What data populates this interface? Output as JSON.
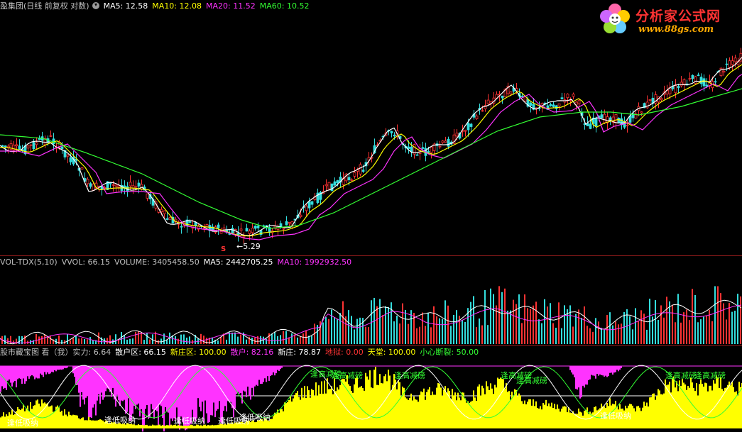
{
  "price_header": {
    "title": "盈集团(日线 前复权 对数)",
    "items": [
      {
        "label": "MA5: 12.58",
        "color": "#ffffff"
      },
      {
        "label": "MA10: 12.08",
        "color": "#ffff00"
      },
      {
        "label": "MA20: 11.52",
        "color": "#ff33ff"
      },
      {
        "label": "MA60: 10.52",
        "color": "#33ff33"
      }
    ]
  },
  "low_marker": {
    "label": "5.29",
    "glyph": "S"
  },
  "logo": {
    "title": "分析家公式网",
    "url": "www.88gs.com",
    "icon": "flower-icon"
  },
  "vol_header": {
    "items": [
      {
        "label": "VOL-TDX(5,10)",
        "color": "#c0c0c0"
      },
      {
        "label": "VVOL: 66.15",
        "color": "#c0c0c0"
      },
      {
        "label": "VOLUME: 3405458.50",
        "color": "#c0c0c0"
      },
      {
        "label": "MA5: 2442705.25",
        "color": "#ffffff"
      },
      {
        "label": "MA10: 1992932.50",
        "color": "#ff33ff"
      }
    ]
  },
  "ind_header": {
    "items": [
      {
        "label": "股市藏宝图 看（我）实力: 6.64",
        "color": "#c0c0c0"
      },
      {
        "label": "散户区: 66.15",
        "color": "#ffffff"
      },
      {
        "label": "新庄区: 100.00",
        "color": "#ffff00"
      },
      {
        "label": "散户: 82.16",
        "color": "#ff33ff"
      },
      {
        "label": "新庄: 78.87",
        "color": "#ffffff"
      },
      {
        "label": "地狱: 0.00",
        "color": "#ff3333"
      },
      {
        "label": "天堂: 100.00",
        "color": "#ffff00"
      },
      {
        "label": "小心断裂: 50.00",
        "color": "#33ff33"
      }
    ]
  },
  "ind_labels": {
    "low": "逢低吸纳",
    "high": "逢高减磅"
  },
  "colors": {
    "up": "#ff3333",
    "down": "#33dddd",
    "ma5": "#ffffff",
    "ma10": "#ffff00",
    "ma20": "#ff33ff",
    "ma60": "#33ff33",
    "magenta_fill": "#ff33ff",
    "yellow_fill": "#ffff00",
    "grid": "#8b1a1a"
  }
}
